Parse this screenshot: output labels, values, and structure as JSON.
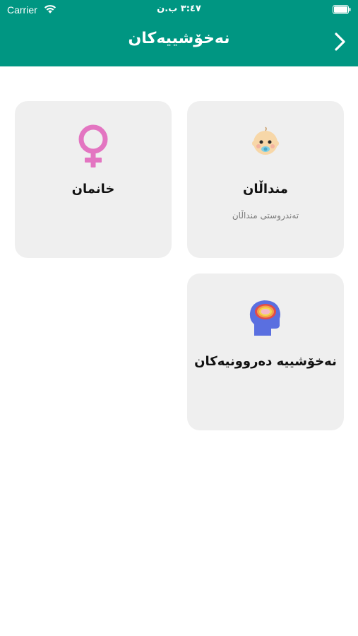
{
  "status_bar": {
    "carrier": "Carrier",
    "time": "٣:٤٧ ب.ن"
  },
  "header": {
    "title": "نەخۆشییەکان",
    "background_color": "#009682"
  },
  "cards": [
    {
      "title": "منداڵان",
      "subtitle": "تەندروستی منداڵان",
      "icon": "baby-face-icon"
    },
    {
      "title": "خانمان",
      "icon": "female-symbol-icon",
      "icon_color": "#e375c1"
    },
    {
      "title": "نەخۆشییە دەروونیەکان",
      "icon": "brain-head-icon",
      "icon_color": "#5a6fe0"
    }
  ]
}
